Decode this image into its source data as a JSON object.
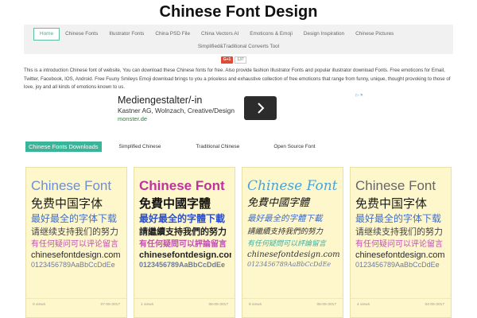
{
  "site": {
    "title": "Chinese Font Design"
  },
  "nav": {
    "items": [
      {
        "label": "Home",
        "active": true
      },
      {
        "label": "Chinese Fonts"
      },
      {
        "label": "Illustrator Fonts"
      },
      {
        "label": "China PSD File"
      },
      {
        "label": "China Vectors AI"
      },
      {
        "label": "Emoticons & Emoji"
      },
      {
        "label": "Design Inspiration"
      },
      {
        "label": "Chinese Pictures"
      }
    ],
    "second_row": "Simplified&Traditional Converts Tool"
  },
  "share": {
    "gplus_label": "G+1",
    "count": "137"
  },
  "intro_text": "This is a introduction Chinese font of website, You can download these Chinese fonts for free. Also provide fashion Illustrator Fonts and popular illustrator download Fonts. Free emoticons for Email, Twitter, Facebook, IOS, Android. Free Fuuny Smileys Emoji download brings to you a priceless and exhaustive collection of free emoticons that range from funny, unique, thought provoking to those of love, joy and all kinds of emotions known to us.",
  "ad": {
    "headline": "Mediengestalter/-in",
    "description": "Kastner AG, Wolnzach, Creative/Design",
    "url": "monster.de",
    "badge": "▷ ✕"
  },
  "tabs": [
    {
      "label": "Chinese Fonts Downloads",
      "active": true
    },
    {
      "label": "Simplified Chinese"
    },
    {
      "label": "Traditional Chinese"
    },
    {
      "label": "Open Source Font"
    }
  ],
  "cards": [
    {
      "lines": [
        "Chinese Font",
        "免费中国字体",
        "最好最全的字体下载",
        "请继续支持我们的努力",
        "有任何疑问可以评论留言",
        "chinesefontdesign.com",
        "0123456789AaBbCcDdEe"
      ],
      "colors": [
        "#6b8fd6",
        "#1a1a1a",
        "#3b6fd4",
        "#444444",
        "#c04fb2",
        "#2a2a2a",
        "#6b7a9a"
      ],
      "views": "0 views",
      "date": "07-09-2017"
    },
    {
      "lines": [
        "Chinese Font",
        "免費中國字體",
        "最好最全的字體下載",
        "請繼續支持我們的努力",
        "有任何疑問可以評論留言",
        "chinesefontdesign.com",
        "0123456789AaBbCcDdEe"
      ],
      "colors": [
        "#c0309e",
        "#111111",
        "#2a4fd0",
        "#222222",
        "#c04fb2",
        "#222222",
        "#6b7a9a"
      ],
      "views": "1 views",
      "date": "06-09-2017"
    },
    {
      "lines": [
        "Chinese Font",
        "免費中國字體",
        "最好最全的字體下載",
        "請繼續支持我們的努力",
        "有任何疑問可以評論留言",
        "chinesefontdesign.com",
        "0123456789AaBbCcDdEe"
      ],
      "colors": [
        "#4aa3d6",
        "#111111",
        "#3b6fd4",
        "#333333",
        "#3bb0a0",
        "#333333",
        "#6b7a9a"
      ],
      "views": "9 views",
      "date": "05-09-2017"
    },
    {
      "lines": [
        "Chinese Font",
        "免费中国字体",
        "最好最全的字体下载",
        "请继续支持我们的努力",
        "有任何疑问可以评论留言",
        "chinesefontdesign.com",
        "0123456789AaBbCcDdEe"
      ],
      "colors": [
        "#666666",
        "#1a1a1a",
        "#3b6fd4",
        "#444444",
        "#c04fb2",
        "#2a2a2a",
        "#6b7a9a"
      ],
      "views": "4 views",
      "date": "04-09-2017"
    }
  ],
  "theme": {
    "accent": "#3ab59a",
    "card_bg": "#fff7cc",
    "nav_bg": "#f1f1f1"
  }
}
